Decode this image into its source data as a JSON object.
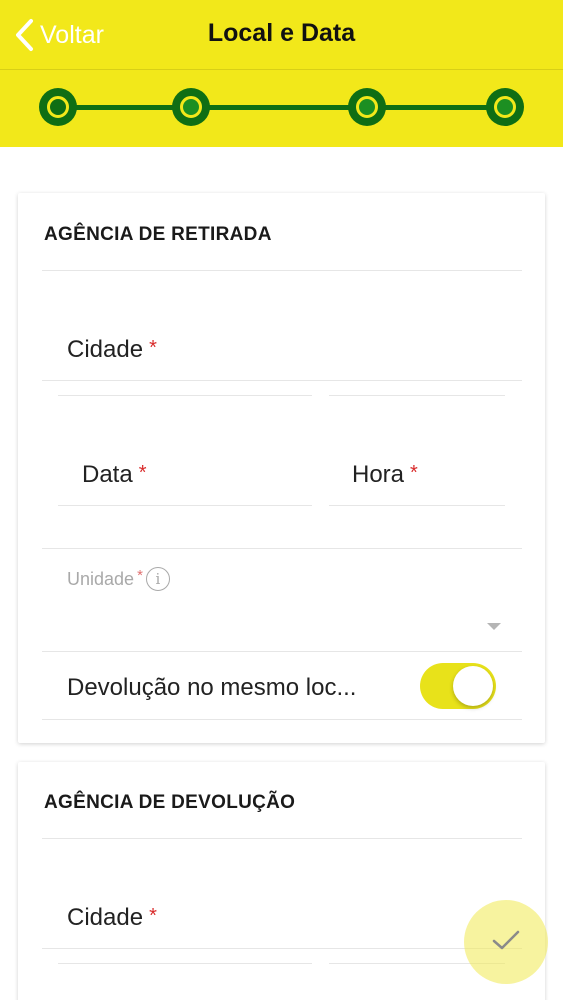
{
  "header": {
    "back_label": "Voltar",
    "title": "Local e Data"
  },
  "stepper": {
    "total_steps": 4,
    "current_step": 1
  },
  "pickup": {
    "title": "AGÊNCIA DE RETIRADA",
    "city_label": "Cidade",
    "date_label": "Data",
    "time_label": "Hora",
    "unit_label": "Unidade",
    "required_mark": "*",
    "same_location_label": "Devolução no mesmo loc...",
    "same_location_enabled": true
  },
  "dropoff": {
    "title": "AGÊNCIA DE DEVOLUÇÃO",
    "city_label": "Cidade",
    "required_mark": "*"
  },
  "icons": {
    "back": "chevron-left-icon",
    "info": "info-icon",
    "dropdown": "caret-down-icon",
    "confirm": "check-icon"
  },
  "colors": {
    "accent_yellow": "#f2e81a",
    "step_green": "#0f6e14",
    "required_red": "#d92b2b"
  },
  "info_glyph": "i"
}
